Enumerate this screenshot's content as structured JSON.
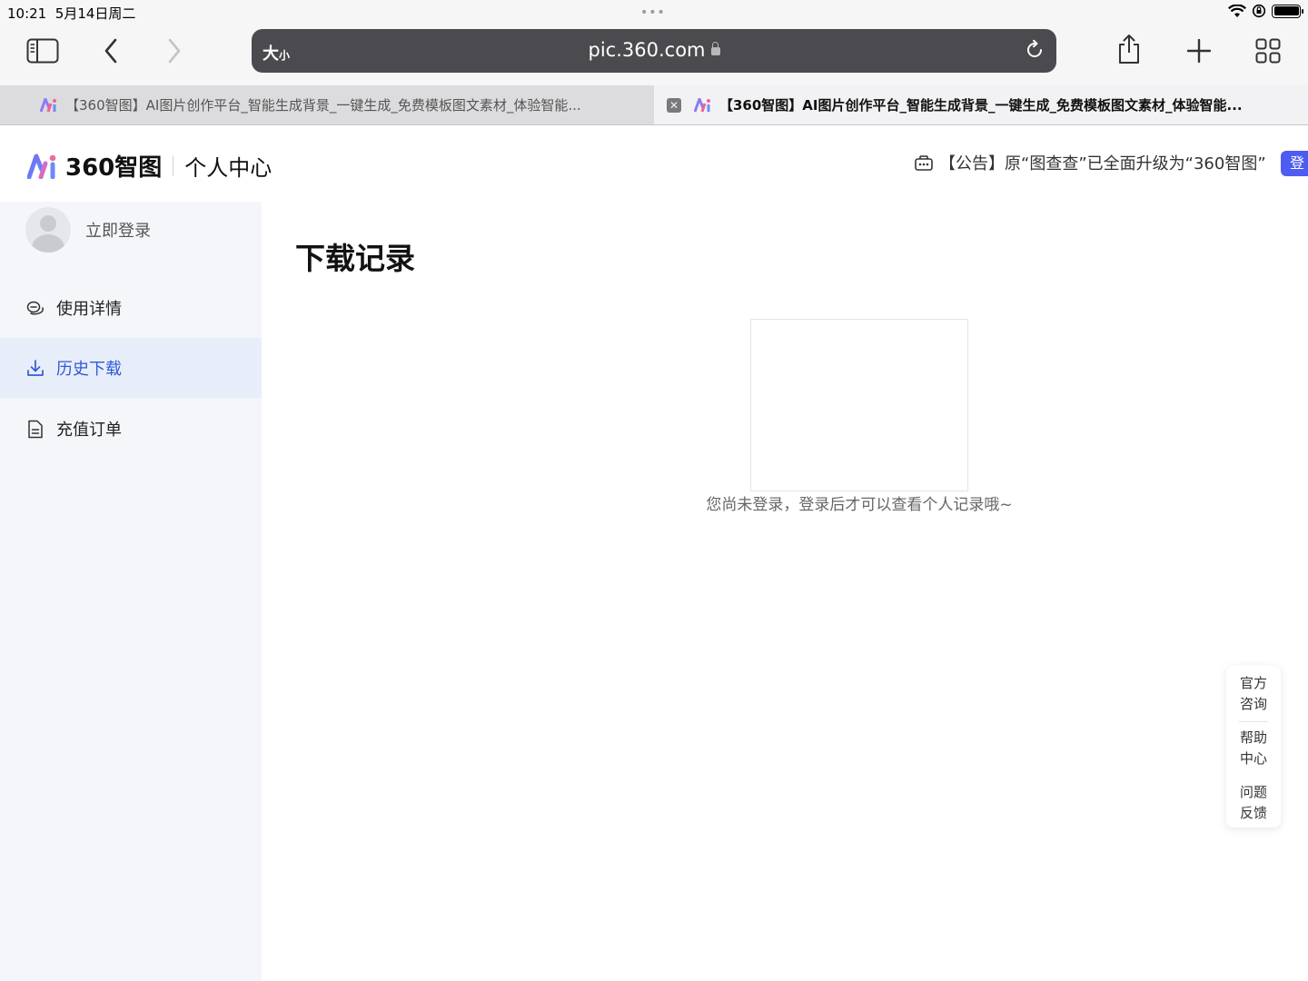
{
  "status_bar": {
    "time": "10:21",
    "date": "5月14日周二",
    "dots": "•••"
  },
  "browser": {
    "address": {
      "text_size_label": "大",
      "text_size_small": "小",
      "url": "pic.360.com"
    },
    "tabs": [
      {
        "title": "【360智图】AI图片创作平台_智能生成背景_一键生成_免费模板图文素材_体验智能...",
        "active": false
      },
      {
        "title": "【360智图】AI图片创作平台_智能生成背景_一键生成_免费模板图文素材_体验智能...",
        "active": true
      }
    ],
    "close_glyph": "✕"
  },
  "header": {
    "brand_name": "360智图",
    "section": "个人中心",
    "notice": "【公告】原“图查查”已全面升级为“360智图”",
    "login_button": "登"
  },
  "sidebar": {
    "login_link": "立即登录",
    "items": [
      {
        "label": "使用详情",
        "icon": "usage-icon",
        "active": false
      },
      {
        "label": "历史下载",
        "icon": "download-icon",
        "active": true
      },
      {
        "label": "充值订单",
        "icon": "document-icon",
        "active": false
      }
    ]
  },
  "main": {
    "title": "下载记录",
    "empty_message": "您尚未登录，登录后才可以查看个人记录哦~"
  },
  "float_help": {
    "items": [
      {
        "line1": "官方",
        "line2": "咨询"
      },
      {
        "line1": "帮助",
        "line2": "中心"
      },
      {
        "line1": "问题",
        "line2": "反馈"
      }
    ]
  },
  "colors": {
    "accent": "#2f5bd8",
    "login_pill": "#4f5cf1",
    "sidebar_bg": "#f4f6f9",
    "sidebar_active_bg": "#e8eef9",
    "address_bar": "#4b4b4f"
  }
}
